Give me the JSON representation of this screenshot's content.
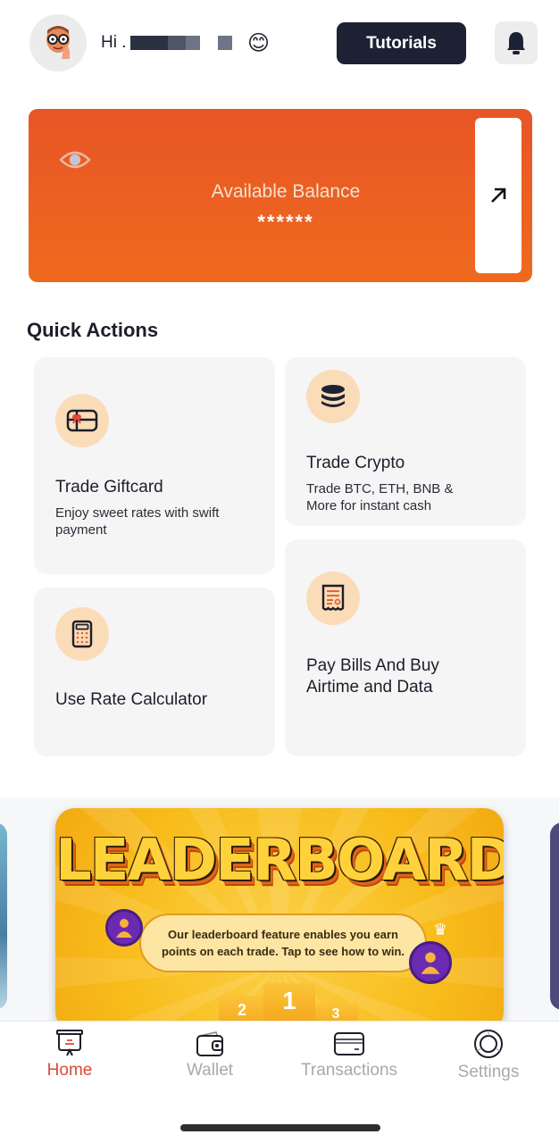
{
  "header": {
    "greeting": "Hi .",
    "emoji": "😊",
    "tutorials_label": "Tutorials",
    "avatar_icon": "memoji-avatar",
    "notification_icon": "bell-icon"
  },
  "balance": {
    "label": "Available Balance",
    "value": "******",
    "toggle_icon": "eye-icon",
    "action_icon": "arrow-up-right-icon",
    "gradient": [
      "#e85526",
      "#ef6a1e"
    ]
  },
  "quick_actions": {
    "title": "Quick Actions",
    "items": [
      {
        "title": "Trade Giftcard",
        "subtitle": "Enjoy sweet rates with swift payment",
        "icon": "giftcard-icon"
      },
      {
        "title": "Trade Crypto",
        "subtitle": "Trade BTC, ETH, BNB & More for instant cash",
        "icon": "coins-stack-icon"
      },
      {
        "title": "Use Rate Calculator",
        "subtitle": "",
        "icon": "calculator-icon"
      },
      {
        "title": "Pay Bills And Buy Airtime and Data",
        "subtitle": "",
        "icon": "receipt-icon"
      }
    ]
  },
  "banner": {
    "title": "LEADERBOARD",
    "text": "Our leaderboard feature enables you earn points on each trade. Tap to see how to win.",
    "podium": [
      "2",
      "1",
      "3"
    ]
  },
  "tabbar": {
    "items": [
      {
        "label": "Home",
        "icon": "home-board-icon",
        "active": true
      },
      {
        "label": "Wallet",
        "icon": "wallet-icon",
        "active": false
      },
      {
        "label": "Transactions",
        "icon": "card-icon",
        "active": false
      },
      {
        "label": "Settings",
        "icon": "settings-icon",
        "active": false
      }
    ],
    "active_color": "#d84a36",
    "inactive_color": "#a9a9a9"
  },
  "colors": {
    "accent": "#ef6a1e",
    "dark": "#1c2233",
    "icon_bg": "#fbdcb8",
    "card_bg": "#f5f5f6"
  }
}
